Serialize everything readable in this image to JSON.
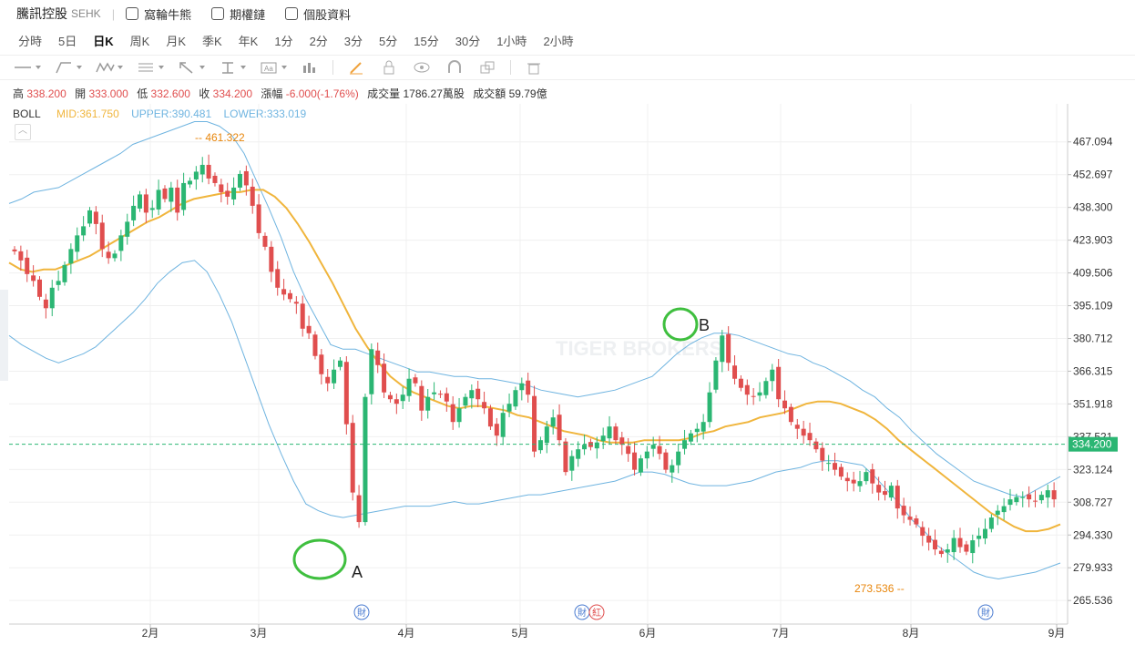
{
  "header": {
    "name": "騰訊控股",
    "market": "SEHK",
    "links": [
      "窩輪牛熊",
      "期權鏈",
      "個股資料"
    ]
  },
  "periods": [
    "分時",
    "5日",
    "日K",
    "周K",
    "月K",
    "季K",
    "年K",
    "1分",
    "2分",
    "3分",
    "5分",
    "15分",
    "30分",
    "1小時",
    "2小時"
  ],
  "active_period": "日K",
  "quote": {
    "high_label": "高",
    "high": "338.200",
    "open_label": "開",
    "open": "333.000",
    "low_label": "低",
    "low": "332.600",
    "close_label": "收",
    "close": "334.200",
    "change_label": "漲幅",
    "change": "-6.000(-1.76%)",
    "volume_label": "成交量",
    "volume": "1786.27萬股",
    "turnover_label": "成交額",
    "turnover": "59.79億"
  },
  "indicator": {
    "name": "BOLL",
    "mid": "MID:361.750",
    "upper": "UPPER:390.481",
    "lower": "LOWER:333.019"
  },
  "colors": {
    "up": "#e04e4e",
    "down": "#2bb673",
    "mid": "#f0b53c",
    "band": "#6fb4e0",
    "last": "#2bb673"
  },
  "chart_data": {
    "type": "candlestick",
    "y_ticks": [
      "467.094",
      "452.697",
      "438.300",
      "423.903",
      "409.506",
      "395.109",
      "380.712",
      "366.315",
      "351.918",
      "337.521",
      "323.124",
      "308.727",
      "294.330",
      "279.933",
      "265.536"
    ],
    "ylim": [
      262,
      475
    ],
    "x_ticks": [
      "2月",
      "3月",
      "4月",
      "5月",
      "6月",
      "7月",
      "8月",
      "9月"
    ],
    "last_price": "334.200",
    "max_label": "461.322",
    "min_label": "273.536",
    "annotations": [
      "A",
      "B"
    ],
    "event_badges": [
      "財",
      "財",
      "紅",
      "財"
    ],
    "watermark": "TIGER BROKERS",
    "closes": [
      419,
      415,
      409,
      406,
      399,
      394,
      403,
      406,
      413,
      420,
      426,
      430,
      437,
      431,
      420,
      416,
      418,
      426,
      432,
      439,
      444,
      436,
      438,
      446,
      442,
      447,
      436,
      449,
      450,
      454,
      457,
      451,
      449,
      445,
      443,
      447,
      453,
      448,
      439,
      427,
      421,
      410,
      403,
      400,
      398,
      396,
      385,
      383,
      373,
      365,
      361,
      367,
      371,
      343,
      313,
      300,
      355,
      376,
      369,
      357,
      354,
      352,
      356,
      363,
      361,
      349,
      355,
      357,
      356,
      353,
      344,
      350,
      355,
      358,
      354,
      350,
      342,
      338,
      348,
      352,
      358,
      361,
      356,
      331,
      336,
      342,
      346,
      336,
      322,
      329,
      332,
      334,
      333,
      335,
      338,
      342,
      336,
      334,
      330,
      323,
      328,
      331,
      334,
      330,
      323,
      325,
      331,
      336,
      339,
      341,
      344,
      357,
      371,
      382,
      370,
      363,
      359,
      356,
      355,
      357,
      362,
      367,
      354,
      350,
      344,
      341,
      338,
      336,
      332,
      327,
      326,
      323,
      320,
      318,
      317,
      318,
      322,
      317,
      313,
      312,
      316,
      306,
      303,
      301,
      299,
      294,
      291,
      288,
      286,
      288,
      293,
      289,
      287,
      292,
      294,
      297,
      302,
      305,
      307,
      310,
      311,
      311,
      310,
      309,
      312,
      314,
      310
    ],
    "mid": [
      414,
      411,
      410,
      411,
      411,
      413,
      415,
      417,
      420,
      423,
      426,
      429,
      432,
      434,
      437,
      440,
      442,
      443,
      444,
      445,
      445,
      446,
      446,
      443,
      438,
      431,
      423,
      414,
      405,
      395,
      385,
      377,
      370,
      364,
      360,
      357,
      355,
      353,
      351,
      350,
      351,
      351,
      350,
      349,
      347,
      346,
      344,
      342,
      340,
      339,
      338,
      336,
      335,
      335,
      335,
      336,
      336,
      336,
      336,
      337,
      339,
      340,
      342,
      343,
      344,
      346,
      347,
      348,
      350,
      352,
      353,
      353,
      352,
      350,
      348,
      345,
      341,
      336,
      332,
      328,
      324,
      320,
      316,
      312,
      308,
      304,
      301,
      298,
      296,
      296,
      297,
      299
    ],
    "upper": [
      440,
      442,
      445,
      446,
      447,
      450,
      453,
      456,
      459,
      462,
      466,
      468,
      470,
      472,
      474,
      476,
      476,
      474,
      470,
      462,
      450,
      438,
      425,
      410,
      398,
      388,
      378,
      376,
      376,
      374,
      372,
      370,
      368,
      366,
      366,
      365,
      364,
      364,
      363,
      363,
      362,
      361,
      360,
      358,
      357,
      356,
      355,
      356,
      357,
      358,
      360,
      362,
      364,
      369,
      374,
      378,
      381,
      383,
      383,
      382,
      380,
      378,
      376,
      374,
      373,
      370,
      368,
      365,
      362,
      358,
      355,
      350,
      346,
      340,
      335,
      330,
      326,
      322,
      318,
      316,
      314,
      312,
      311,
      314,
      317,
      320
    ],
    "lower": [
      382,
      378,
      375,
      372,
      370,
      372,
      374,
      377,
      382,
      387,
      392,
      398,
      405,
      410,
      414,
      415,
      410,
      400,
      388,
      373,
      358,
      343,
      330,
      318,
      308,
      305,
      303,
      302,
      303,
      304,
      305,
      306,
      307,
      307,
      307,
      308,
      309,
      308,
      308,
      309,
      310,
      311,
      312,
      312,
      313,
      314,
      315,
      316,
      317,
      318,
      320,
      322,
      322,
      321,
      319,
      317,
      316,
      316,
      316,
      317,
      318,
      320,
      322,
      323,
      324,
      326,
      327,
      327,
      326,
      325,
      320,
      314,
      308,
      301,
      296,
      290,
      286,
      282,
      278,
      276,
      275,
      276,
      277,
      278,
      280,
      282
    ]
  }
}
